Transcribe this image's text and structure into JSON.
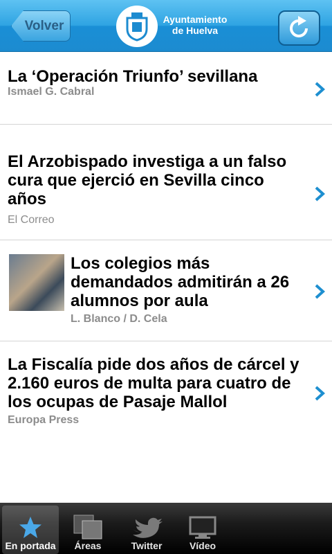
{
  "header": {
    "back_label": "Volver",
    "title_line1": "Ayuntamiento",
    "title_line2": "de Huelva"
  },
  "articles": [
    {
      "title": "La ‘Operación Triunfo’ sevillana",
      "author": "Ismael G. Cabral"
    },
    {
      "title": "El Arzobispado investiga a un falso cura que ejerció en Sevilla cinco años",
      "author": "El Correo"
    },
    {
      "title": "Los colegios más demandados admitirán a 26 alumnos por aula",
      "author": "L. Blanco / D. Cela"
    },
    {
      "title": "La Fiscalía pide dos años de cárcel y 2.160 euros de multa para cuatro de los ocupas de Pasaje Mallol",
      "author": "Europa Press"
    }
  ],
  "tabs": [
    {
      "label": "En portada",
      "icon": "star-icon"
    },
    {
      "label": "Áreas",
      "icon": "areas-icon"
    },
    {
      "label": "Twitter",
      "icon": "twitter-bird-icon"
    },
    {
      "label": "Vídeo",
      "icon": "monitor-icon"
    }
  ],
  "colors": {
    "accent": "#2ea3e2",
    "chevron": "#1e8fd0"
  }
}
